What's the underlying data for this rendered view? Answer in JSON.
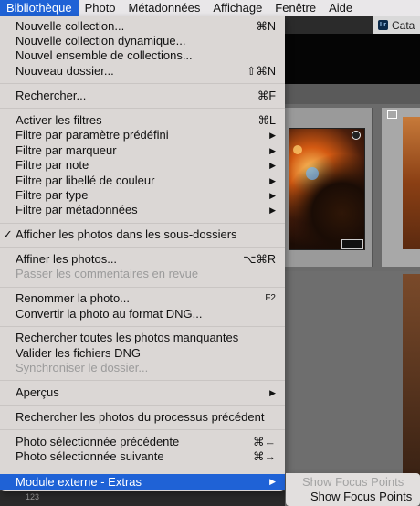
{
  "menubar": {
    "items": [
      "Bibliothèque",
      "Photo",
      "Métadonnées",
      "Affichage",
      "Fenêtre",
      "Aide"
    ]
  },
  "app": {
    "tab_label": "Cata",
    "app_icon": "Lr",
    "left_number": "123"
  },
  "menu": {
    "items": [
      {
        "label": "Nouvelle collection...",
        "shortcut": "⌘N"
      },
      {
        "label": "Nouvelle collection dynamique...",
        "shortcut": ""
      },
      {
        "label": "Nouvel ensemble de collections...",
        "shortcut": ""
      },
      {
        "label": "Nouveau dossier...",
        "shortcut": "⇧⌘N"
      },
      {
        "label": "Rechercher...",
        "shortcut": "⌘F"
      },
      {
        "label": "Activer les filtres",
        "shortcut": "⌘L"
      },
      {
        "label": "Filtre par paramètre prédéfini",
        "shortcut": "▶"
      },
      {
        "label": "Filtre par marqueur",
        "shortcut": "▶"
      },
      {
        "label": "Filtre par note",
        "shortcut": "▶"
      },
      {
        "label": "Filtre par libellé de couleur",
        "shortcut": "▶"
      },
      {
        "label": "Filtre par type",
        "shortcut": "▶"
      },
      {
        "label": "Filtre par métadonnées",
        "shortcut": "▶"
      },
      {
        "label": "Afficher les photos dans les sous-dossiers",
        "shortcut": "",
        "check": "✓"
      },
      {
        "label": "Affiner les photos...",
        "shortcut": "⌥⌘R"
      },
      {
        "label": "Passer les commentaires en revue",
        "shortcut": ""
      },
      {
        "label": "Renommer la photo...",
        "shortcut": "F2"
      },
      {
        "label": "Convertir la photo au format DNG...",
        "shortcut": ""
      },
      {
        "label": "Rechercher toutes les photos manquantes",
        "shortcut": ""
      },
      {
        "label": "Valider les fichiers DNG",
        "shortcut": ""
      },
      {
        "label": "Synchroniser le dossier...",
        "shortcut": ""
      },
      {
        "label": "Aperçus",
        "shortcut": "▶"
      },
      {
        "label": "Rechercher les photos du processus précédent",
        "shortcut": ""
      },
      {
        "label": "Photo sélectionnée précédente",
        "shortcut": "⌘←"
      },
      {
        "label": "Photo sélectionnée suivante",
        "shortcut": "⌘→"
      },
      {
        "label": "Module externe - Extras",
        "shortcut": "▶"
      }
    ]
  },
  "submenu": {
    "items": [
      {
        "label": "Show Focus Points"
      },
      {
        "label": "Show Focus Points"
      }
    ]
  },
  "colors": {
    "highlight": "#1f62d6",
    "menu_bg": "#e0dcda",
    "disabled_text": "#9b9b9b"
  }
}
